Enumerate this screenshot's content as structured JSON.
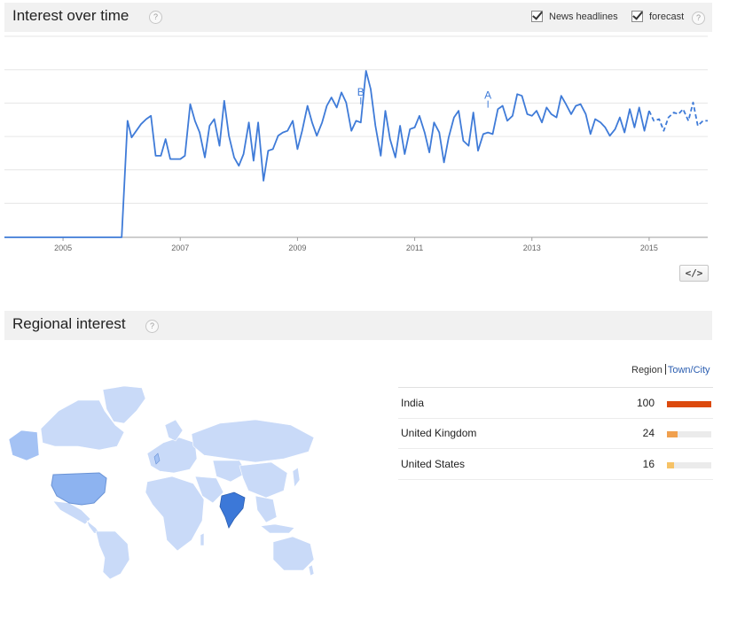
{
  "interest": {
    "title": "Interest over time",
    "help_symbol": "?",
    "news_headlines_label": "News headlines",
    "forecast_label": "forecast",
    "embed_label": "</>",
    "chart_data": {
      "type": "line",
      "x_start": 2004.0,
      "x_end": 2016.0,
      "x_tick_labels": [
        "2005",
        "2007",
        "2009",
        "2011",
        "2013",
        "2015"
      ],
      "x_tick_values": [
        2005,
        2007,
        2009,
        2011,
        2013,
        2015
      ],
      "ylim": [
        0,
        100
      ],
      "grid": true,
      "line_color": "#3f7bd8",
      "annotations": [
        {
          "label": "A",
          "x": 2012.25,
          "y": 80
        },
        {
          "label": "B",
          "x": 2010.08,
          "y": 82
        }
      ],
      "series": [
        {
          "style": "solid",
          "x": [
            2004.0,
            2006.0,
            2006.1,
            2006.17,
            2006.25,
            2006.33,
            2006.42,
            2006.5,
            2006.58,
            2006.67,
            2006.75,
            2006.83,
            2006.92,
            2007.0,
            2007.08,
            2007.17,
            2007.25,
            2007.33,
            2007.42,
            2007.5,
            2007.58,
            2007.67,
            2007.75,
            2007.83,
            2007.92,
            2008.0,
            2008.08,
            2008.17,
            2008.25,
            2008.33,
            2008.42,
            2008.5,
            2008.58,
            2008.67,
            2008.75,
            2008.83,
            2008.92,
            2009.0,
            2009.08,
            2009.17,
            2009.25,
            2009.33,
            2009.42,
            2009.5,
            2009.58,
            2009.67,
            2009.75,
            2009.83,
            2009.92,
            2010.0,
            2010.08,
            2010.17,
            2010.25,
            2010.33,
            2010.42,
            2010.5,
            2010.58,
            2010.67,
            2010.75,
            2010.83,
            2010.92,
            2011.0,
            2011.08,
            2011.17,
            2011.25,
            2011.33,
            2011.42,
            2011.5,
            2011.58,
            2011.67,
            2011.75,
            2011.83,
            2011.92,
            2012.0,
            2012.08,
            2012.17,
            2012.25,
            2012.33,
            2012.42,
            2012.5,
            2012.58,
            2012.67,
            2012.75,
            2012.83,
            2012.92,
            2013.0,
            2013.08,
            2013.17,
            2013.25,
            2013.33,
            2013.42,
            2013.5,
            2013.58,
            2013.67,
            2013.75,
            2013.83,
            2013.92,
            2014.0,
            2014.08,
            2014.17,
            2014.25,
            2014.33,
            2014.42,
            2014.5,
            2014.58,
            2014.67,
            2014.75,
            2014.83,
            2014.92,
            2015.0
          ],
          "y": [
            0,
            0,
            70,
            60,
            64,
            68,
            71,
            73,
            49,
            49,
            59,
            47,
            47,
            47,
            49,
            80,
            70,
            63,
            48,
            67,
            71,
            55,
            82,
            61,
            48,
            43,
            50,
            69,
            46,
            69,
            34,
            52,
            53,
            61,
            63,
            64,
            70,
            53,
            64,
            79,
            69,
            61,
            69,
            79,
            84,
            78,
            87,
            81,
            64,
            70,
            69,
            100,
            89,
            67,
            49,
            76,
            59,
            48,
            67,
            50,
            65,
            66,
            73,
            63,
            51,
            69,
            63,
            45,
            60,
            72,
            76,
            58,
            55,
            75,
            52,
            62,
            63,
            62,
            77,
            79,
            70,
            73,
            86,
            85,
            74,
            73,
            76,
            69,
            78,
            74,
            72,
            85,
            80,
            74,
            79,
            80,
            74,
            62,
            71,
            69,
            66,
            61,
            65,
            72,
            63,
            77,
            66,
            78,
            64,
            76
          ]
        },
        {
          "style": "dashed",
          "x": [
            2015.0,
            2015.08,
            2015.17,
            2015.25,
            2015.33,
            2015.42,
            2015.5,
            2015.58,
            2015.67,
            2015.75,
            2015.83,
            2015.92,
            2016.0
          ],
          "y": [
            76,
            70,
            71,
            64,
            72,
            75,
            74,
            77,
            70,
            81,
            67,
            70,
            70
          ]
        }
      ]
    }
  },
  "regional": {
    "title": "Regional interest",
    "help_symbol": "?",
    "region_label": "Region",
    "city_label": "Town/City",
    "highlight_colors": {
      "india": "#3c78d8",
      "united_kingdom": "#a4c2f4",
      "united_states": "#8db3f0",
      "other": "#c9daf8"
    },
    "rows": [
      {
        "name": "India",
        "value": 100,
        "color": "#dc4a0e"
      },
      {
        "name": "United Kingdom",
        "value": 24,
        "color": "#f0a04e"
      },
      {
        "name": "United States",
        "value": 16,
        "color": "#f6c266"
      }
    ]
  }
}
